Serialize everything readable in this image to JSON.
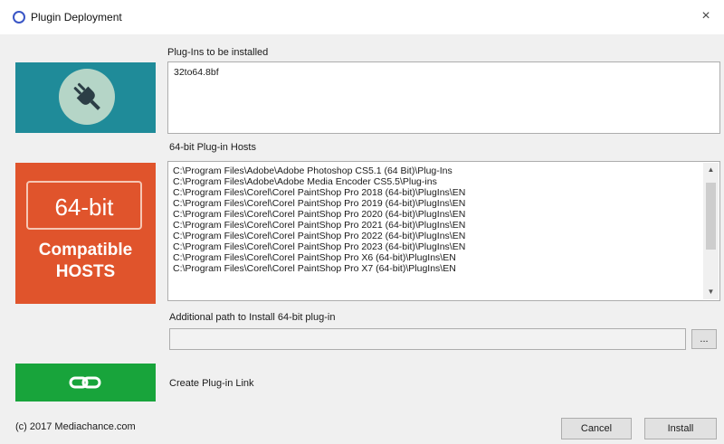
{
  "window": {
    "title": "Plugin Deployment",
    "close_glyph": "×"
  },
  "plugins": {
    "label": "Plug-Ins to be installed",
    "items": [
      "32to64.8bf"
    ]
  },
  "hosts": {
    "label": "64-bit Plug-in Hosts",
    "items": [
      "C:\\Program Files\\Adobe\\Adobe Photoshop CS5.1 (64 Bit)\\Plug-Ins",
      "C:\\Program Files\\Adobe\\Adobe Media Encoder CS5.5\\Plug-ins",
      "C:\\Program Files\\Corel\\Corel PaintShop Pro 2018 (64-bit)\\PlugIns\\EN",
      "C:\\Program Files\\Corel\\Corel PaintShop Pro 2019 (64-bit)\\PlugIns\\EN",
      "C:\\Program Files\\Corel\\Corel PaintShop Pro 2020 (64-bit)\\PlugIns\\EN",
      "C:\\Program Files\\Corel\\Corel PaintShop Pro 2021 (64-bit)\\PlugIns\\EN",
      "C:\\Program Files\\Corel\\Corel PaintShop Pro 2022 (64-bit)\\PlugIns\\EN",
      "C:\\Program Files\\Corel\\Corel PaintShop Pro 2023 (64-bit)\\PlugIns\\EN",
      "C:\\Program Files\\Corel\\Corel PaintShop Pro X6 (64-bit)\\PlugIns\\EN",
      "C:\\Program Files\\Corel\\Corel PaintShop Pro X7 (64-bit)\\PlugIns\\EN"
    ]
  },
  "hosts_tile": {
    "badge": "64-bit",
    "line1": "Compatible",
    "line2": "HOSTS"
  },
  "additional_path": {
    "label": "Additional path to Install 64-bit plug-in",
    "value": "",
    "browse_label": "..."
  },
  "link": {
    "label": "Create Plug-in Link"
  },
  "footer": {
    "copyright": "(c) 2017 Mediachance.com",
    "cancel_label": "Cancel",
    "install_label": "Install"
  },
  "icons": {
    "plugin_tile": "plug-icon",
    "link_tile": "link-icon",
    "app": "app-icon"
  },
  "colors": {
    "plugin_tile": "#1f8b99",
    "hosts_tile": "#e0542c",
    "link_tile": "#18a43b",
    "app_icon": "#3a56c6"
  }
}
